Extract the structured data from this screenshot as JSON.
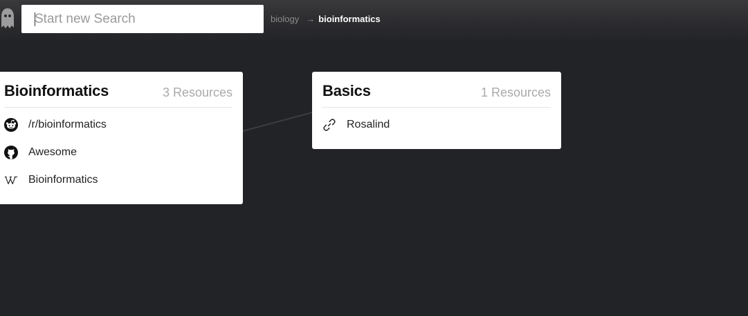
{
  "header": {
    "search_placeholder": "Start new Search",
    "breadcrumb": {
      "parent": "biology",
      "separator": "→",
      "current": "bioinformatics"
    }
  },
  "cards": [
    {
      "title": "Bioinformatics",
      "count": "3",
      "count_label": "Resources",
      "items": [
        {
          "icon": "reddit-icon",
          "label": "/r/bioinformatics"
        },
        {
          "icon": "github-icon",
          "label": "Awesome"
        },
        {
          "icon": "wikipedia-icon",
          "label": "Bioinformatics"
        }
      ]
    },
    {
      "title": "Basics",
      "count": "1",
      "count_label": "Resources",
      "items": [
        {
          "icon": "link-icon",
          "label": "Rosalind"
        }
      ]
    }
  ],
  "colors": {
    "background": "#222326",
    "card": "#ffffff",
    "muted_text": "#aaaaaa",
    "breadcrumb_muted": "#8a8a8c"
  }
}
